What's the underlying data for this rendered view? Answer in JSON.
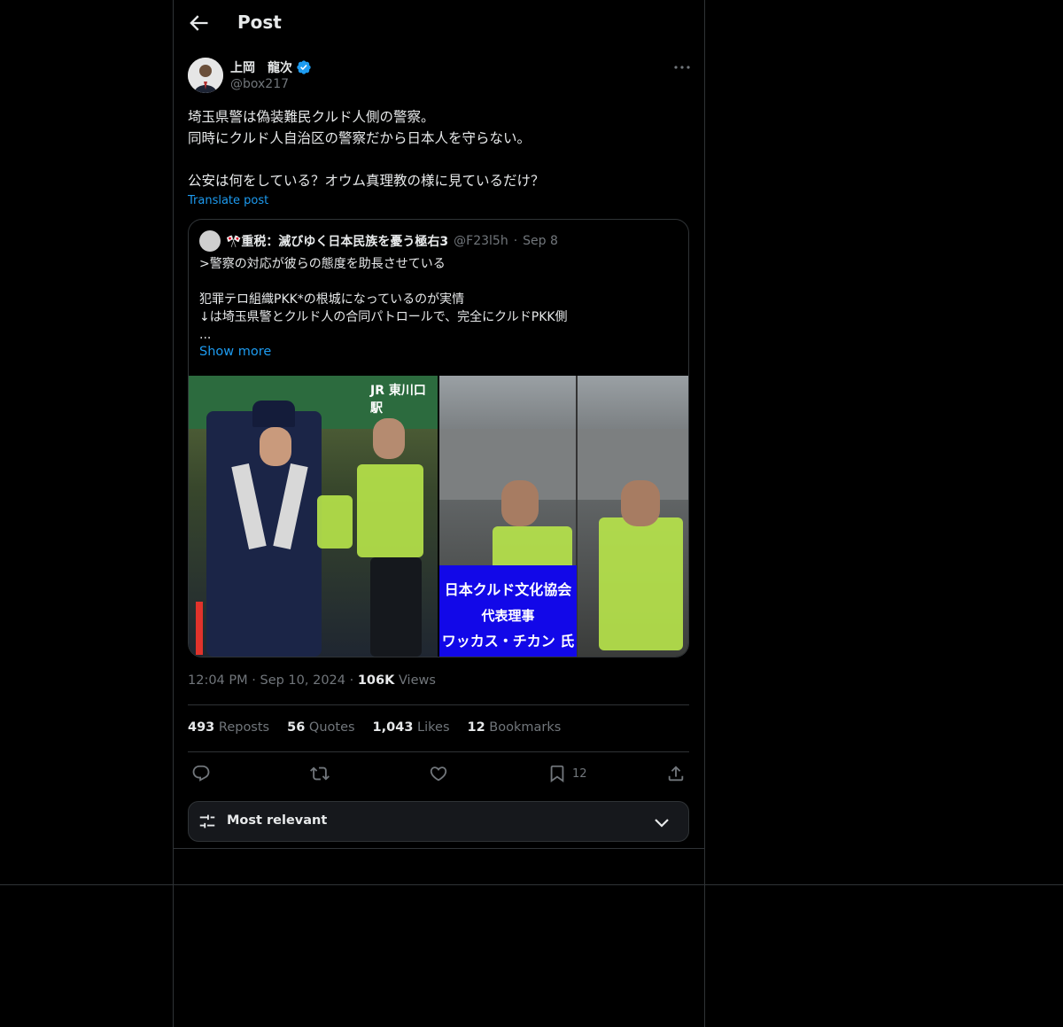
{
  "header": {
    "title": "Post"
  },
  "post": {
    "author_name": "上岡　龍次",
    "author_handle": "@box217",
    "text": "埼玉県警は偽装難民クルド人側の警察。\n同時にクルド人自治区の警察だから日本人を守らない。\n\n公安は何をしている？オウム真理教の様に見ているだけ？",
    "translate_label": "Translate post",
    "time": "12:04 PM",
    "date": "Sep 10, 2024",
    "views_count": "106K",
    "views_label": "Views"
  },
  "quote": {
    "name": "🎌重税：滅びゆく日本民族を憂う極右3",
    "handle": "@F23l5h",
    "date": "Sep 8",
    "text": ">警察の対応が彼らの態度を助長させている\n\n犯罪テロ組織PKK*の根城になっているのが実情\n↓は埼玉県警とクルド人の合同パトロールで、完全にクルドPKK側\n...",
    "show_more": "Show more",
    "image_banner_line1": "日本クルド文化協会",
    "image_banner_line2": "代表理事",
    "image_banner_line3": "ワッカス・チカン 氏",
    "station_sign": "JR 東川口駅"
  },
  "stats": [
    {
      "count": "493",
      "label": "Reposts"
    },
    {
      "count": "56",
      "label": "Quotes"
    },
    {
      "count": "1,043",
      "label": "Likes"
    },
    {
      "count": "12",
      "label": "Bookmarks"
    }
  ],
  "actions": {
    "reply_icon": "reply-icon",
    "repost_icon": "repost-icon",
    "like_icon": "like-icon",
    "bookmark_icon": "bookmark-icon",
    "bookmark_count": "12",
    "share_icon": "share-icon"
  },
  "sort": {
    "label": "Most relevant"
  },
  "colors": {
    "accent": "#1d9bf0",
    "muted": "#71767b",
    "text": "#e7e9ea",
    "border": "#2f3336",
    "background": "#000000"
  }
}
